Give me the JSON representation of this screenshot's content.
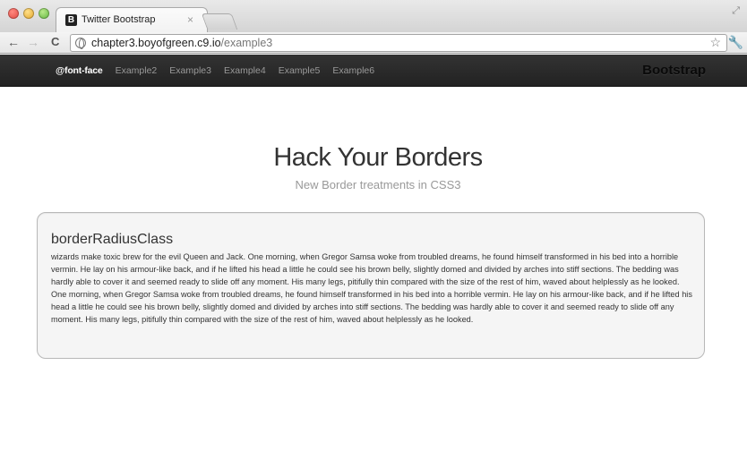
{
  "browser": {
    "tab_title": "Twitter Bootstrap",
    "tab_favicon": "B",
    "tab_close": "×",
    "url_host": "chapter3.boyofgreen.c9.io",
    "url_path": "/example3",
    "icons": [
      "back-arrow-icon",
      "forward-arrow-icon",
      "reload-icon",
      "globe-icon",
      "star-icon",
      "wrench-icon"
    ]
  },
  "navbar": {
    "links": [
      "@font-face",
      "Example2",
      "Example3",
      "Example4",
      "Example5",
      "Example6"
    ],
    "brand": "Bootstrap",
    "colors": {
      "bg": "#2b2b2b",
      "active": "#ffffff",
      "inactive": "#999999"
    }
  },
  "hero": {
    "title": "Hack Your Borders",
    "subtitle": "New Border treatments in CSS3"
  },
  "card": {
    "title": "borderRadiusClass",
    "body": "wizards make toxic brew for the evil Queen and Jack. One morning, when Gregor Samsa woke from troubled dreams, he found himself transformed in his bed into a horrible vermin. He lay on his armour-like back, and if he lifted his head a little he could see his brown belly, slightly domed and divided by arches into stiff sections. The bedding was hardly able to cover it and seemed ready to slide off any moment. His many legs, pitifully thin compared with the size of the rest of him, waved about helplessly as he looked. One morning, when Gregor Samsa woke from troubled dreams, he found himself transformed in his bed into a horrible vermin. He lay on his armour-like back, and if he lifted his head a little he could see his brown belly, slightly domed and divided by arches into stiff sections. The bedding was hardly able to cover it and seemed ready to slide off any moment. His many legs, pitifully thin compared with the size of the rest of him, waved about helplessly as he looked."
  }
}
